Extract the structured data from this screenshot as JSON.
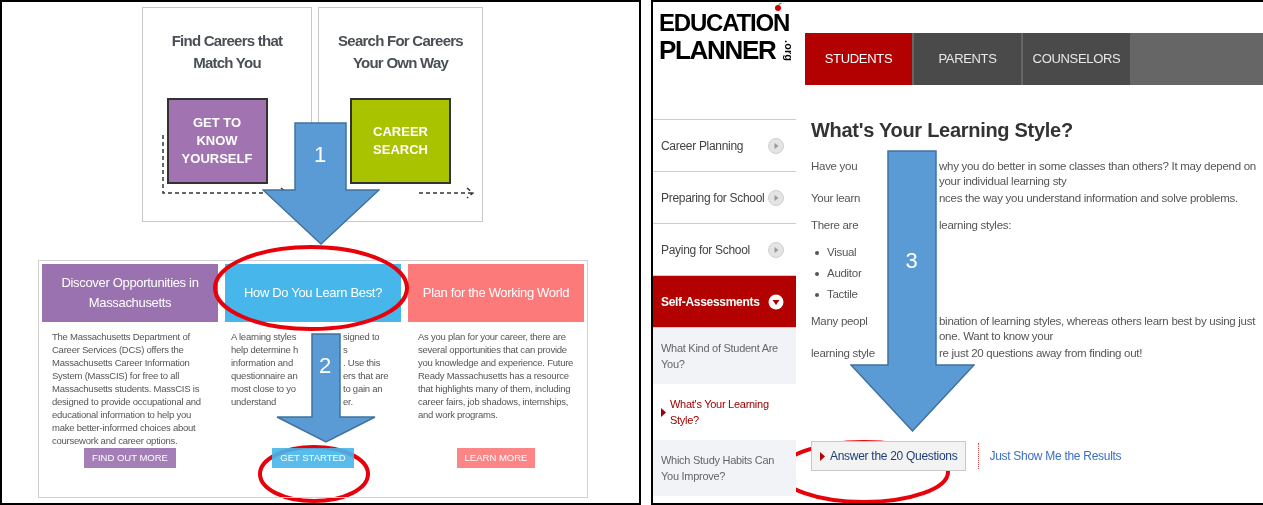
{
  "left_page": {
    "top_cards": [
      {
        "title": "Find Careers that Match You",
        "button": "GET TO KNOW YOURSELF",
        "color": "#a173b0"
      },
      {
        "title": "Search For Careers Your Own Way",
        "button": "CAREER SEARCH",
        "color": "#a9c300"
      }
    ],
    "sections": [
      {
        "kind": "text",
        "title": "Discover Opportunities in Massachusetts",
        "color": "#9b72b0",
        "text": "The Massachusetts Department of Career Services (DCS) offers the Massachusetts Career Information System (MassCIS) for free to all Massachusetts students. MassCIS is designed to provide occupational and educational information to help you make better-informed choices about coursework and career options.",
        "button": "FIND OUT MORE"
      },
      {
        "kind": "fragments",
        "title": "How Do You Learn Best?",
        "color": "#47b6ea",
        "lines": [
          {
            "left": "A learning styles",
            "right": "signed to"
          },
          {
            "left": "help determine h",
            "right": "s"
          },
          {
            "left": "information and",
            "right": ". Use this"
          },
          {
            "left": "questionnaire an",
            "right": "ers that are"
          },
          {
            "left": "most close to yo",
            "right": "to gain an"
          },
          {
            "left": "understand",
            "right": "er."
          }
        ],
        "button": "GET STARTED"
      },
      {
        "kind": "text",
        "title": "Plan for the Working World",
        "color": "#fc7a7a",
        "text": "As you plan for your career, there are several opportunities that can provide you knowledge and experience. Future Ready Massachusetts has a resource that highlights many of them, including career fairs, job shadows, internships, and work programs.",
        "button": "LEARN MORE"
      }
    ]
  },
  "right_page": {
    "logo": {
      "line_1": "EDUCATION",
      "line_2": "PLANNER",
      "suffix": ".org"
    },
    "nav_tabs": [
      {
        "label": "STUDENTS",
        "selected": true
      },
      {
        "label": "PARENTS",
        "selected": false
      },
      {
        "label": "COUNSELORS",
        "selected": false
      }
    ],
    "sidebar": {
      "items": [
        {
          "label": "Career Planning",
          "expanded": false
        },
        {
          "label": "Preparing for School",
          "expanded": false
        },
        {
          "label": "Paying for School",
          "expanded": false
        },
        {
          "label": "Self-Assessments",
          "expanded": true,
          "children": [
            {
              "label": "What Kind of Student Are You?",
              "selected": false
            },
            {
              "label": "What's Your Learning Style?",
              "selected": true
            },
            {
              "label": "Which Study Habits Can You Improve?",
              "selected": false
            }
          ]
        }
      ]
    },
    "content": {
      "title": "What's Your Learning Style?",
      "blocks": [
        {
          "kind": "split",
          "lines": [
            {
              "left": "Have you",
              "right": "why you do better in some classes than others? It may depend on your individual learning sty"
            },
            {
              "left": "Your learn",
              "right": "nces the way you understand information and solve problems."
            }
          ]
        },
        {
          "kind": "split",
          "lines": [
            {
              "left": "There are",
              "right": "learning styles:"
            }
          ]
        },
        {
          "kind": "bullets",
          "items": [
            "Visual",
            "Auditor",
            "Tactile"
          ]
        },
        {
          "kind": "split",
          "lines": [
            {
              "left": "Many peopl",
              "right": "bination of learning styles, whereas others learn best by using just one. Want to know your"
            },
            {
              "left": "learning style",
              "right": "re just 20 questions away from finding out!"
            }
          ]
        }
      ],
      "primary_button": "Answer the 20 Questions",
      "link": "Just Show Me the Results"
    }
  },
  "annotations": [
    {
      "kind": "arrow",
      "label": "1"
    },
    {
      "kind": "ellipse"
    },
    {
      "kind": "arrow",
      "label": "2"
    },
    {
      "kind": "ellipse"
    },
    {
      "kind": "arrow",
      "label": "3"
    },
    {
      "kind": "ellipse"
    }
  ]
}
